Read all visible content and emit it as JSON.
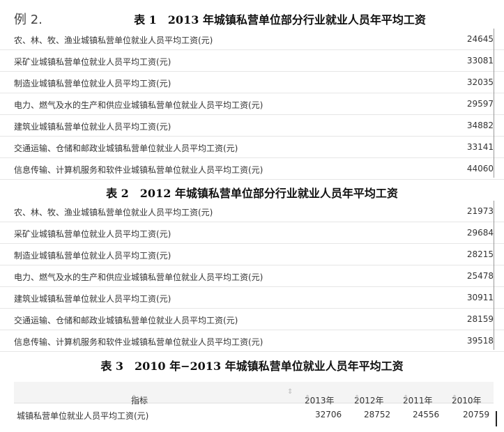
{
  "example_label": "例 2.",
  "tables": [
    {
      "title": "表 1　2013 年城镇私营单位部分行业就业人员年平均工资",
      "rows": [
        {
          "label": "农、林、牧、渔业城镇私营单位就业人员平均工资(元)",
          "value": "24645"
        },
        {
          "label": "采矿业城镇私营单位就业人员平均工资(元)",
          "value": "33081"
        },
        {
          "label": "制造业城镇私营单位就业人员平均工资(元)",
          "value": "32035"
        },
        {
          "label": "电力、燃气及水的生产和供应业城镇私营单位就业人员平均工资(元)",
          "value": "29597"
        },
        {
          "label": "建筑业城镇私营单位就业人员平均工资(元)",
          "value": "34882"
        },
        {
          "label": "交通运输、仓储和邮政业城镇私营单位就业人员平均工资(元)",
          "value": "33141"
        },
        {
          "label": "信息传输、计算机服务和软件业城镇私营单位就业人员平均工资(元)",
          "value": "44060"
        }
      ]
    },
    {
      "title": "表 2　2012 年城镇私营单位部分行业就业人员年平均工资",
      "rows": [
        {
          "label": "农、林、牧、渔业城镇私营单位就业人员平均工资(元)",
          "value": "21973"
        },
        {
          "label": "采矿业城镇私营单位就业人员平均工资(元)",
          "value": "29684"
        },
        {
          "label": "制造业城镇私营单位就业人员平均工资(元)",
          "value": "28215"
        },
        {
          "label": "电力、燃气及水的生产和供应业城镇私营单位就业人员平均工资(元)",
          "value": "25478"
        },
        {
          "label": "建筑业城镇私营单位就业人员平均工资(元)",
          "value": "30911"
        },
        {
          "label": "交通运输、仓储和邮政业城镇私营单位就业人员平均工资(元)",
          "value": "28159"
        },
        {
          "label": "信息传输、计算机服务和软件业城镇私营单位就业人员平均工资(元)",
          "value": "39518"
        }
      ]
    }
  ],
  "table3": {
    "title": "表 3　2010 年−2013 年城镇私营单位就业人员年平均工资",
    "header": {
      "indicator": "指标",
      "y2013": "2013年",
      "y2012": "2012年",
      "y2011": "2011年",
      "y2010": "2010年",
      "sort_glyph": "⇕"
    },
    "row": {
      "label": "城镇私营单位就业人员平均工资(元)",
      "v2013": "32706",
      "v2012": "28752",
      "v2011": "24556",
      "v2010": "20759"
    }
  }
}
